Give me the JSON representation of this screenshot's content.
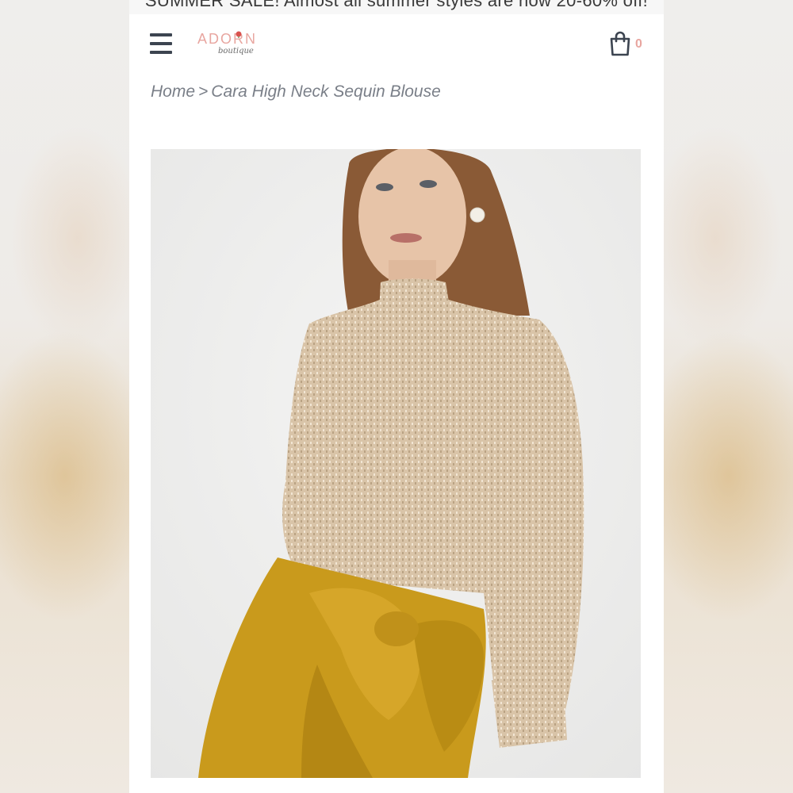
{
  "promo": {
    "text": "SUMMER SALE! Almost all summer styles are now 20-60% off!"
  },
  "header": {
    "logo_main": "ADORN",
    "logo_sub": "boutique",
    "cart_count": "0"
  },
  "breadcrumb": {
    "home": "Home",
    "separator": ">",
    "current": "Cara High Neck Sequin Blouse"
  },
  "product": {
    "image_alt": "Cara High Neck Sequin Blouse"
  },
  "colors": {
    "brand_pink": "#e8a6a0",
    "icon_dark": "#3c4450",
    "breadcrumb_gray": "#7a7f88"
  },
  "icons": {
    "menu": "hamburger-menu-icon",
    "cart": "shopping-bag-icon"
  }
}
